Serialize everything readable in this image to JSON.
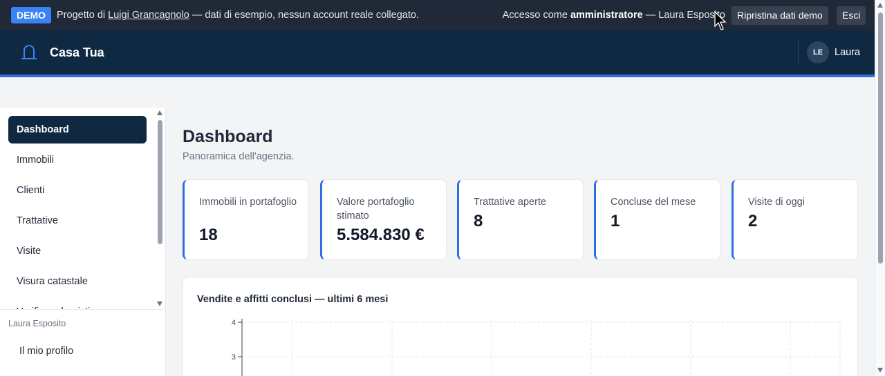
{
  "demo_bar": {
    "badge": "DEMO",
    "text_prefix": "Progetto di",
    "author_link": "Luigi Grancagnolo",
    "text_suffix": "— dati di esempio, nessun account reale collegato.",
    "access_prefix": "Accesso come",
    "access_role": "amministratore",
    "access_suffix": "— Laura Esposito",
    "reset_button": "Ripristina dati demo",
    "exit_button": "Esci"
  },
  "header": {
    "brand": "Casa Tua",
    "avatar_initials": "LE",
    "user_name": "Laura"
  },
  "sidebar": {
    "items": [
      {
        "label": "Dashboard",
        "active": true
      },
      {
        "label": "Immobili"
      },
      {
        "label": "Clienti"
      },
      {
        "label": "Trattative"
      },
      {
        "label": "Visite"
      },
      {
        "label": "Visura catastale"
      },
      {
        "label": "Verifica urbanistica"
      }
    ],
    "footer_user": "Laura Esposito",
    "footer_link": "Il mio profilo"
  },
  "page": {
    "title": "Dashboard",
    "subtitle": "Panoramica dell'agenzia."
  },
  "stats": [
    {
      "label": "Immobili in portafoglio",
      "value": "18"
    },
    {
      "label": "Valore portafoglio stimato",
      "value": "5.584.830 €"
    },
    {
      "label": "Trattative aperte",
      "value": "8"
    },
    {
      "label": "Concluse del mese",
      "value": "1"
    },
    {
      "label": "Visite di oggi",
      "value": "2"
    }
  ],
  "chart_data": {
    "type": "bar",
    "title": "Vendite e affitti conclusi — ultimi 6 mesi",
    "y_tick_labels": [
      "4",
      "3"
    ],
    "ylim": [
      0,
      4
    ],
    "grid": true
  },
  "colors": {
    "accent": "#2f6fe0",
    "header_bg": "#0f2942",
    "demo_bar_bg": "#1f2937",
    "badge_bg": "#3b82f6"
  }
}
